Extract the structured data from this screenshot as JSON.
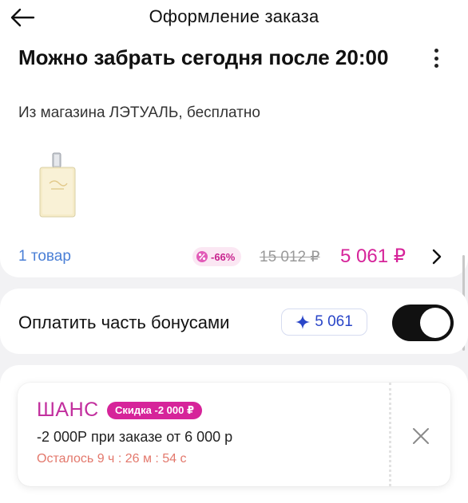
{
  "header": {
    "title": "Оформление заказа",
    "back_icon": "arrow-left-icon",
    "more_icon": "more-vertical-icon"
  },
  "delivery": {
    "title": "Можно забрать сегодня после 20:00",
    "subtitle": "Из магазина ЛЭТУАЛЬ, бесплатно"
  },
  "order": {
    "items_count": "1 товар",
    "discount": "-66%",
    "old_price": "15 012 ₽",
    "new_price": "5 061 ₽",
    "chevron_icon": "chevron-right-icon"
  },
  "bonus": {
    "label": "Оплатить часть бонусами",
    "amount": "5 061",
    "star_icon": "sparkle-icon",
    "toggle_on": true
  },
  "promo": {
    "name": "ШАНС",
    "badge": "Скидка -2 000 ₽",
    "condition": "-2 000Р при заказе от 6 000 р",
    "timer": "Осталось 9 ч : 26 м : 54 с",
    "close_icon": "close-icon"
  },
  "colors": {
    "accent_pink": "#d6249a",
    "link_blue": "#4a7fd6",
    "bonus_blue": "#2a46c8",
    "timer_red": "#e3786c"
  }
}
